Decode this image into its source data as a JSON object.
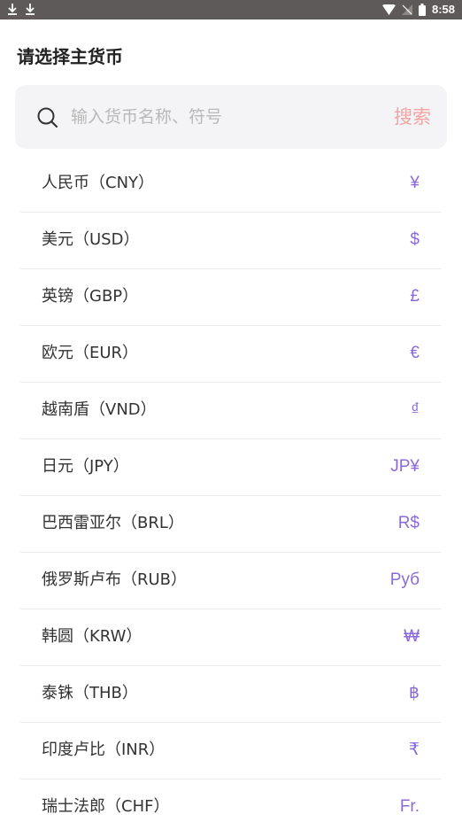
{
  "status_bar": {
    "time": "8:58"
  },
  "sheet": {
    "title": "请选择主货币"
  },
  "search": {
    "placeholder": "输入货币名称、符号",
    "value": "",
    "button_label": "搜索"
  },
  "colors": {
    "accent_symbol": "#8a6ad8",
    "search_button": "#f2a3a3"
  },
  "currencies": [
    {
      "name": "人民币（CNY）",
      "symbol": "¥"
    },
    {
      "name": "美元（USD）",
      "symbol": "$"
    },
    {
      "name": "英镑（GBP）",
      "symbol": "£"
    },
    {
      "name": "欧元（EUR）",
      "symbol": "€"
    },
    {
      "name": "越南盾（VND）",
      "symbol": "₫"
    },
    {
      "name": "日元（JPY）",
      "symbol": "JP¥"
    },
    {
      "name": "巴西雷亚尔（BRL）",
      "symbol": "R$"
    },
    {
      "name": "俄罗斯卢布（RUB）",
      "symbol": "Руб"
    },
    {
      "name": "韩圆（KRW）",
      "symbol": "₩"
    },
    {
      "name": "泰铢（THB）",
      "symbol": "฿"
    },
    {
      "name": "印度卢比（INR）",
      "symbol": "₹"
    },
    {
      "name": "瑞士法郎（CHF）",
      "symbol": "Fr."
    }
  ]
}
